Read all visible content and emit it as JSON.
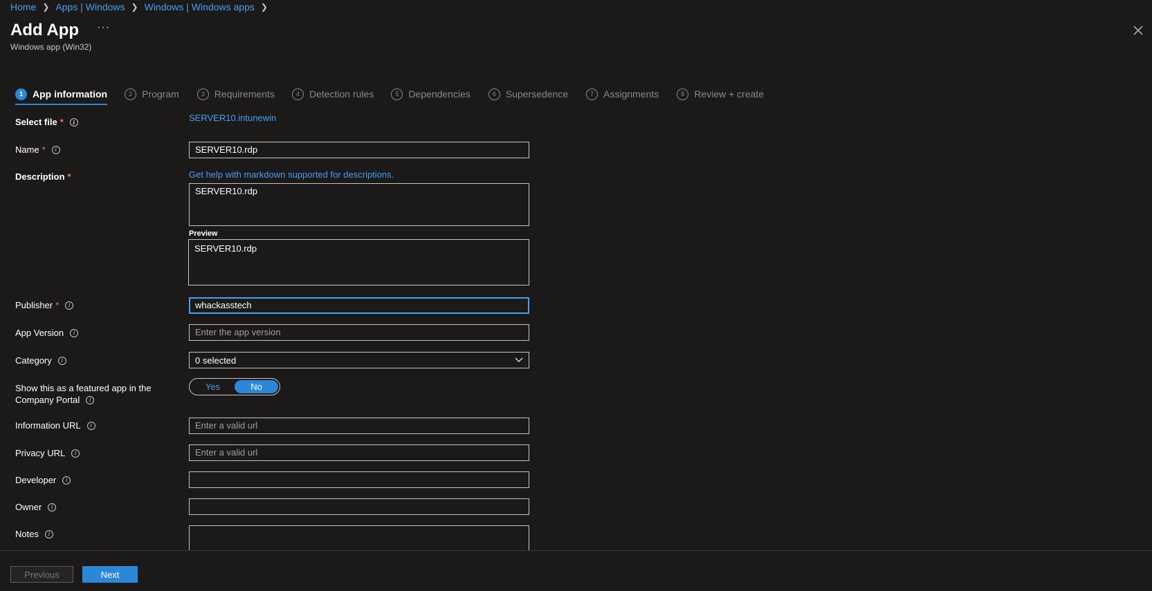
{
  "breadcrumb": {
    "items": [
      "Home",
      "Apps | Windows",
      "Windows | Windows apps"
    ]
  },
  "header": {
    "title": "Add App",
    "subtitle": "Windows app (Win32)",
    "more_icon": "ellipsis-icon",
    "close_icon": "close-icon"
  },
  "steps": [
    {
      "num": "1",
      "label": "App information"
    },
    {
      "num": "2",
      "label": "Program"
    },
    {
      "num": "3",
      "label": "Requirements"
    },
    {
      "num": "4",
      "label": "Detection rules"
    },
    {
      "num": "5",
      "label": "Dependencies"
    },
    {
      "num": "6",
      "label": "Supersedence"
    },
    {
      "num": "7",
      "label": "Assignments"
    },
    {
      "num": "8",
      "label": "Review + create"
    }
  ],
  "form": {
    "select_file": {
      "label": "Select file",
      "value": "SERVER10.intunewin"
    },
    "name": {
      "label": "Name",
      "value": "SERVER10.rdp"
    },
    "description": {
      "label": "Description",
      "help_link": "Get help with markdown supported for descriptions.",
      "value": "SERVER10.rdp",
      "preview_label": "Preview",
      "preview_value": "SERVER10.rdp"
    },
    "publisher": {
      "label": "Publisher",
      "value": "whackasstech"
    },
    "app_version": {
      "label": "App Version",
      "placeholder": "Enter the app version"
    },
    "category": {
      "label": "Category",
      "value": "0 selected"
    },
    "featured": {
      "label_line1": "Show this as a featured app in the",
      "label_line2": "Company Portal",
      "yes": "Yes",
      "no": "No",
      "selected": "No"
    },
    "information_url": {
      "label": "Information URL",
      "placeholder": "Enter a valid url"
    },
    "privacy_url": {
      "label": "Privacy URL",
      "placeholder": "Enter a valid url"
    },
    "developer": {
      "label": "Developer",
      "value": ""
    },
    "owner": {
      "label": "Owner",
      "value": ""
    },
    "notes": {
      "label": "Notes",
      "value": ""
    }
  },
  "footer": {
    "previous": "Previous",
    "next": "Next"
  },
  "colors": {
    "background": "#1b1a19",
    "accent": "#2b88d8",
    "link": "#479ef5",
    "required": "#f1707b"
  }
}
